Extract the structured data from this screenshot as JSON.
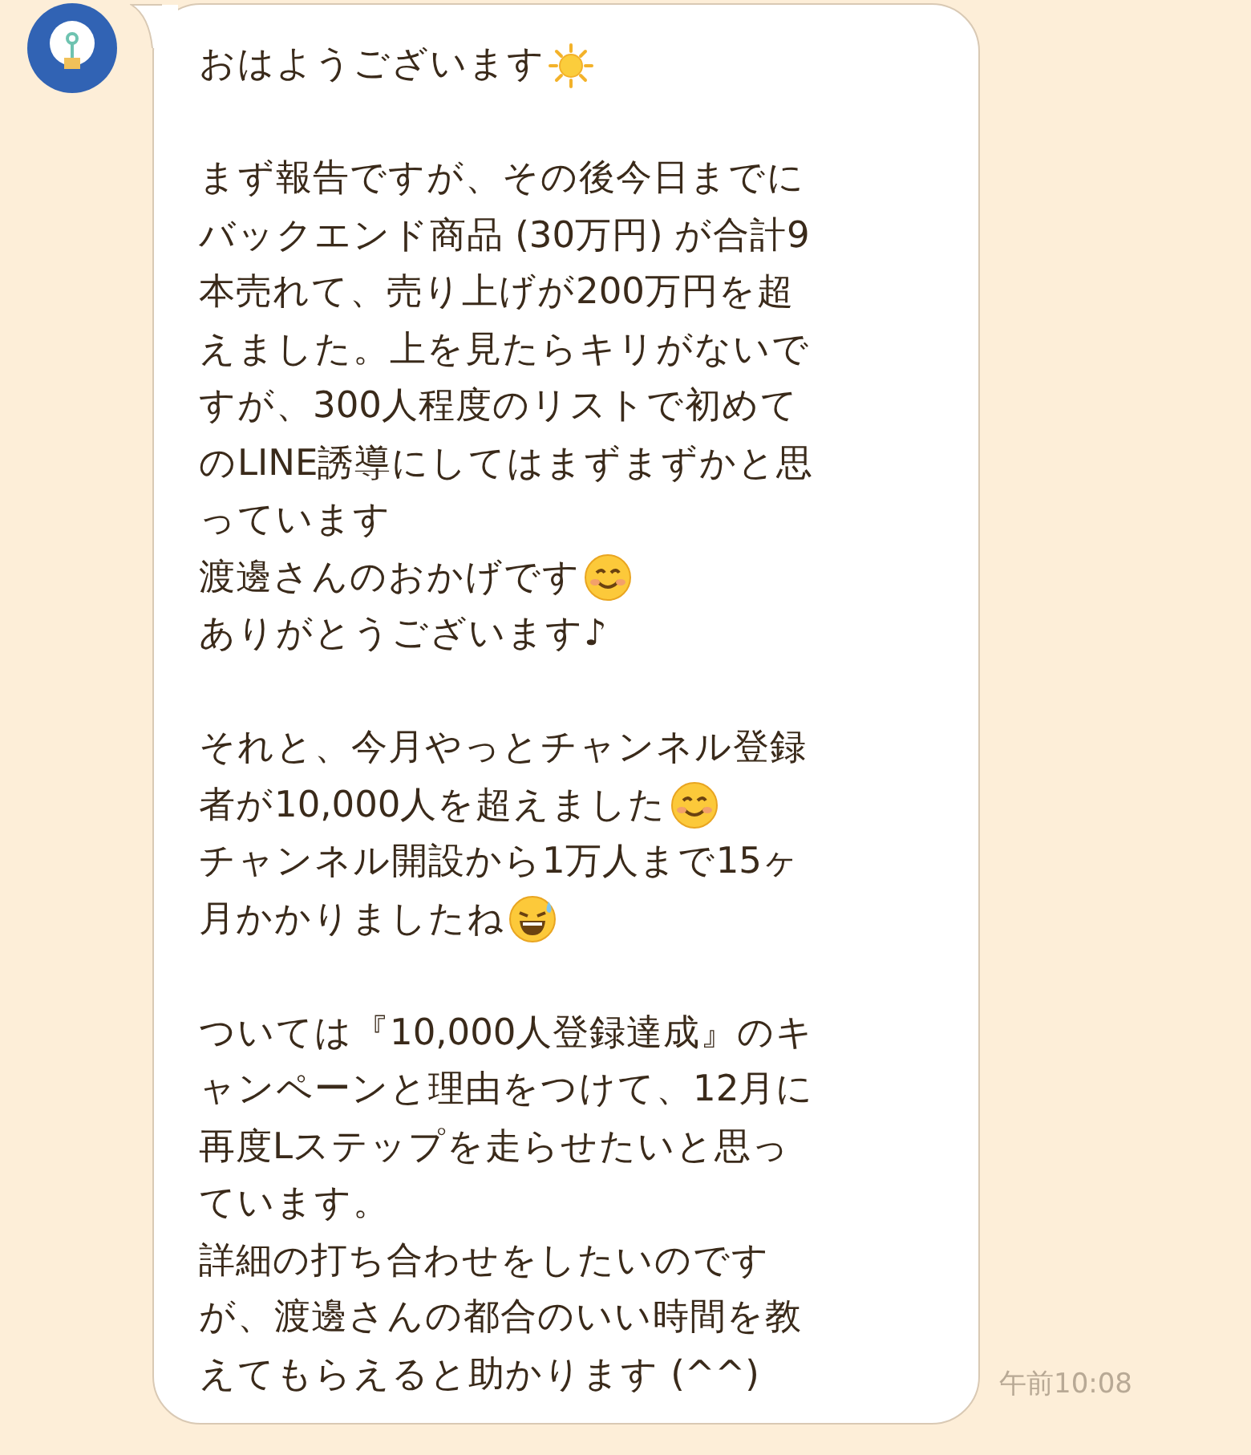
{
  "message": {
    "paragraphs": [
      [
        [
          {
            "kind": "text",
            "text": "おはようございます"
          },
          {
            "kind": "sun"
          }
        ]
      ],
      [
        [
          {
            "kind": "text",
            "text": "まず報告ですが、その後今日までに"
          }
        ],
        [
          {
            "kind": "text",
            "text": "バックエンド商品 (30万円) が合計9"
          }
        ],
        [
          {
            "kind": "text",
            "text": "本売れて、売り上げが200万円を超"
          }
        ],
        [
          {
            "kind": "text",
            "text": "えました。上を見たらキリがないで"
          }
        ],
        [
          {
            "kind": "text",
            "text": "すが、300人程度のリストで初めて"
          }
        ],
        [
          {
            "kind": "text",
            "text": "のLINE誘導にしてはまずまずかと思"
          }
        ],
        [
          {
            "kind": "text",
            "text": "っています"
          }
        ],
        [
          {
            "kind": "text",
            "text": "渡邊さんのおかげです"
          },
          {
            "kind": "smile"
          }
        ],
        [
          {
            "kind": "text",
            "text": "ありがとうございます♪"
          }
        ]
      ],
      [
        [
          {
            "kind": "text",
            "text": "それと、今月やっとチャンネル登録"
          }
        ],
        [
          {
            "kind": "text",
            "text": "者が10,000人を超えました"
          },
          {
            "kind": "smile"
          }
        ],
        [
          {
            "kind": "text",
            "text": "チャンネル開設から1万人まで15ヶ"
          }
        ],
        [
          {
            "kind": "text",
            "text": "月かかりましたね"
          },
          {
            "kind": "sweat"
          }
        ]
      ],
      [
        [
          {
            "kind": "text",
            "text": "ついては『10,000人登録達成』のキ"
          }
        ],
        [
          {
            "kind": "text",
            "text": "ャンペーンと理由をつけて、12月に"
          }
        ],
        [
          {
            "kind": "text",
            "text": "再度Lステップを走らせたいと思っ"
          }
        ],
        [
          {
            "kind": "text",
            "text": "ています。"
          }
        ],
        [
          {
            "kind": "text",
            "text": "詳細の打ち合わせをしたいのです"
          }
        ],
        [
          {
            "kind": "text",
            "text": "が、渡邊さんの都合のいい時間を教"
          }
        ],
        [
          {
            "kind": "text",
            "text": "えてもらえると助かります (^^)"
          }
        ]
      ]
    ],
    "time": "午前10:08"
  }
}
